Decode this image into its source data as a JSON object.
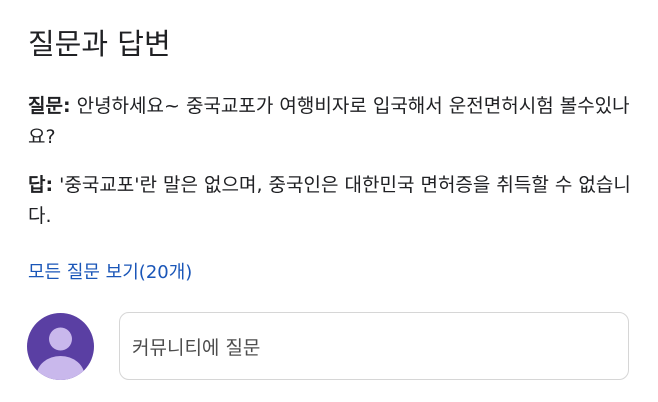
{
  "section": {
    "title": "질문과 답변"
  },
  "question": {
    "label": "질문:",
    "text": " 안녕하세요~ 중국교포가 여행비자로 입국해서 운전면허시험 볼수있나요?"
  },
  "answer": {
    "label": "답:",
    "text": " '중국교포'란 말은 없으며, 중국인은 대한민국 면허증을 취득할 수 없습니다."
  },
  "links": {
    "view_all": "모든 질문 보기(20개)"
  },
  "community": {
    "ask_placeholder": "커뮤니티에 질문"
  },
  "colors": {
    "link": "#1a56b8",
    "avatar_bg": "#5a3fa3",
    "avatar_figure": "#c9b8ec"
  },
  "icons": {
    "avatar": "default-user-avatar-icon"
  }
}
